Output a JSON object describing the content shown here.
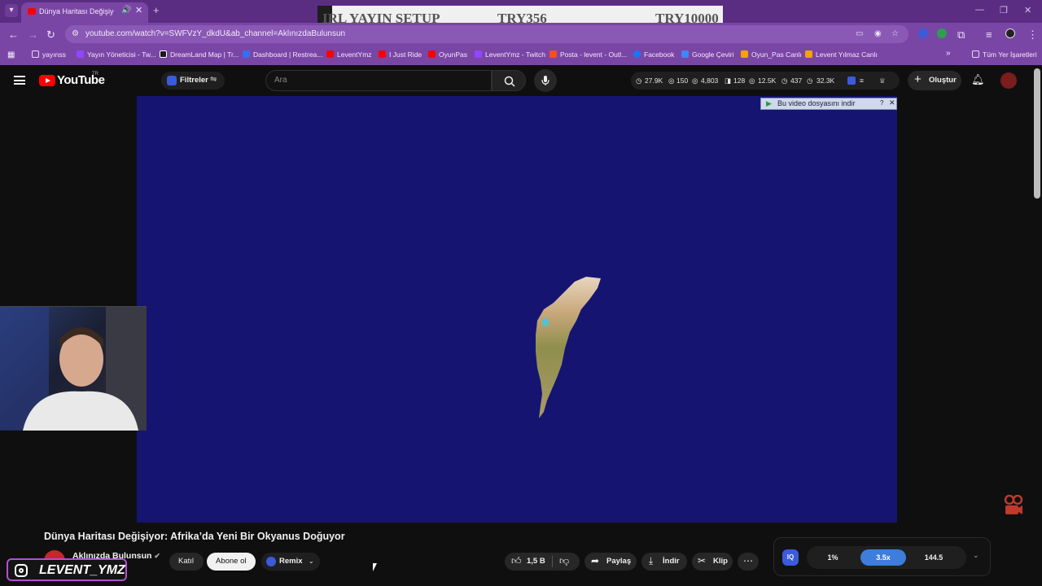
{
  "browser": {
    "tab_title": "Dünya Haritası Değişiyor: A",
    "url": "youtube.com/watch?v=SWFVzY_dkdU&ab_channel=AklınızdaBulunsun"
  },
  "overlay": {
    "left_text": "IRL YAYIN SETUP",
    "mid_text": "TRY356",
    "right_text": "TRY10000"
  },
  "bookmarks": [
    {
      "label": "yayınss",
      "icon": "folder-icon",
      "color": "#e8d8f5"
    },
    {
      "label": "Yayın Yöneticisi - Tw...",
      "icon": "twitch-icon",
      "color": "#9146ff"
    },
    {
      "label": "DreamLand Map | Tr...",
      "icon": "page-icon",
      "color": "#1a1a1a"
    },
    {
      "label": "Dashboard | Restrea...",
      "icon": "restream-icon",
      "color": "#3a6df0"
    },
    {
      "label": "LeventYmz",
      "icon": "youtube-icon",
      "color": "#ff0000"
    },
    {
      "label": "I Just Ride",
      "icon": "youtube-icon",
      "color": "#ff0000"
    },
    {
      "label": "OyunPas",
      "icon": "youtube-icon",
      "color": "#ff0000"
    },
    {
      "label": "LeventYmz - Twitch",
      "icon": "twitch-icon",
      "color": "#9146ff"
    },
    {
      "label": "Posta - levent - Outl...",
      "icon": "microsoft-icon",
      "color": "#f25022"
    },
    {
      "label": "Facebook",
      "icon": "facebook-icon",
      "color": "#1877f2"
    },
    {
      "label": "Google Çeviri",
      "icon": "translate-icon",
      "color": "#4285f4"
    },
    {
      "label": "Oyun_Pas Canlı",
      "icon": "analytics-icon",
      "color": "#f4a300"
    },
    {
      "label": "Levent Yılmaz Canlı",
      "icon": "analytics-icon",
      "color": "#f4a300"
    }
  ],
  "bookmarks_all": "Tüm Yer İşaretleri",
  "youtube": {
    "logo_text": "YouTube",
    "country_code": "TR",
    "filters_label": "Filtreler",
    "search_placeholder": "Ara",
    "stats": [
      "27.9K",
      "150",
      "4,803",
      "128",
      "12.5K",
      "437",
      "32.3K"
    ],
    "create_label": "Oluştur"
  },
  "video": {
    "download_banner": "Bu video dosyasını indir",
    "title": "Dünya Haritası Değişiyor: Afrika’da Yeni Bir Okyanus Doğuyor",
    "channel": "Aklınızda Bulunsun",
    "join_label": "Katıl",
    "subscribe_label": "Abone ol",
    "remix_label": "Remix",
    "likes": "1,5 B",
    "share_label": "Paylaş",
    "download_label": "İndir",
    "clip_label": "Klip",
    "background_color": "#161471"
  },
  "iq_panel": {
    "values": [
      "1%",
      "3.5x",
      "144.5"
    ]
  },
  "streamer": {
    "instagram_handle": "LEVENT_YMZ"
  }
}
